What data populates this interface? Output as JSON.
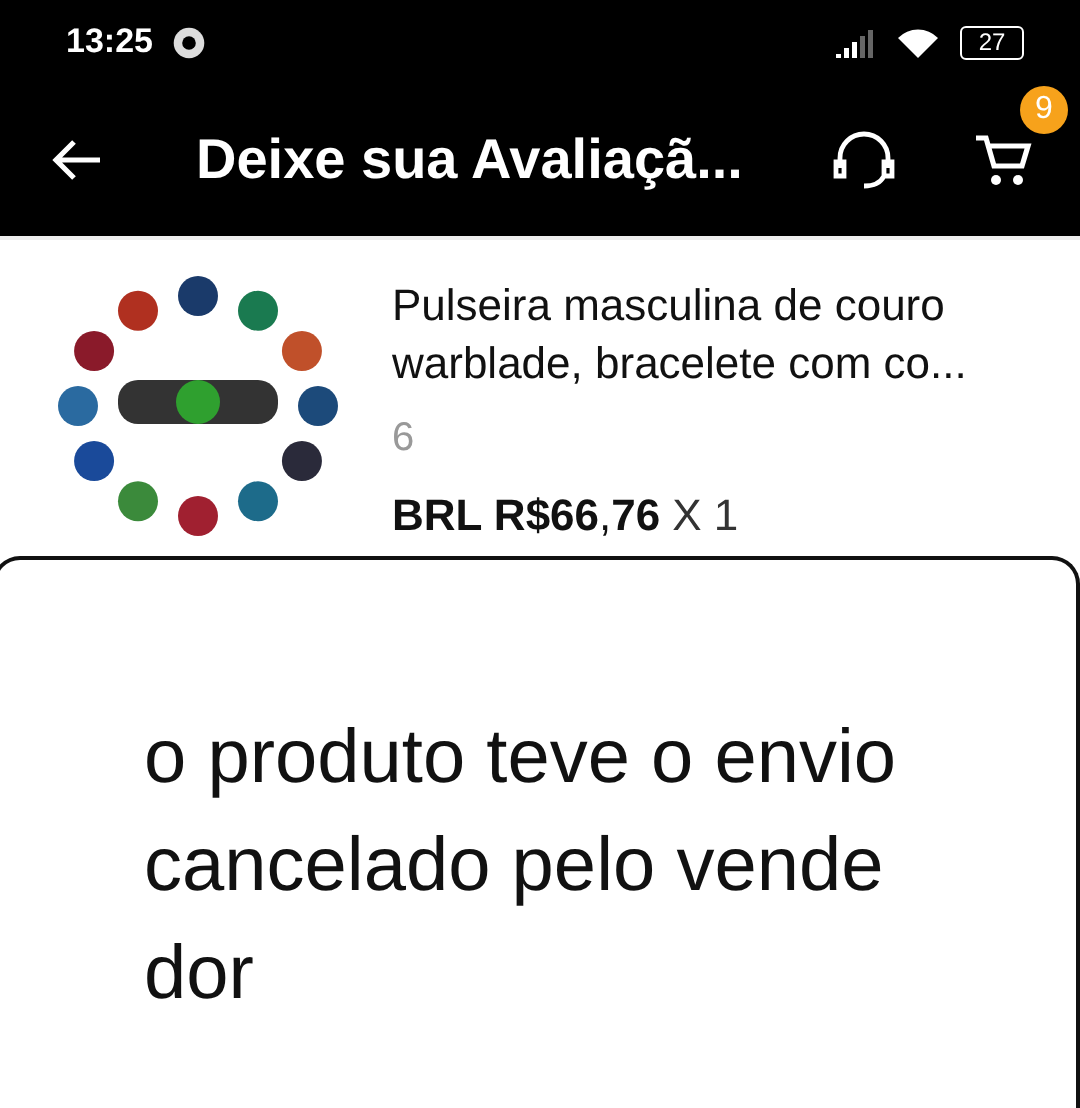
{
  "status_bar": {
    "time": "13:25",
    "battery": "27"
  },
  "header": {
    "title": "Deixe sua Avaliaçã...",
    "cart_count": "9"
  },
  "product": {
    "name": "Pulseira masculina de couro warblade, bracelete com co...",
    "count": "6",
    "price": "**BRL R$66**,**76**",
    "quantity": "X 1"
  },
  "review": {
    "value": "o produto teve o envio cancelado pelo vendedor"
  }
}
